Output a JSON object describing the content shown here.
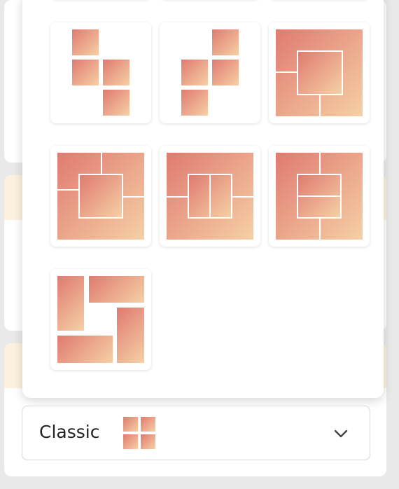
{
  "layout_picker": {
    "options": [
      {
        "id": "staggered-left",
        "label": ""
      },
      {
        "id": "staggered-right",
        "label": ""
      },
      {
        "id": "center-frame",
        "label": ""
      },
      {
        "id": "pinwheel-frame",
        "label": ""
      },
      {
        "id": "center-split-vertical",
        "label": ""
      },
      {
        "id": "center-split-horizontal",
        "label": ""
      },
      {
        "id": "spiral",
        "label": ""
      }
    ],
    "gradient": {
      "start": "#e07a70",
      "end": "#f5d0a5"
    }
  },
  "selector": {
    "label": "Classic",
    "thumbnail_icon": "grid-2x2-icon",
    "dropdown_icon": "chevron-down-icon"
  }
}
